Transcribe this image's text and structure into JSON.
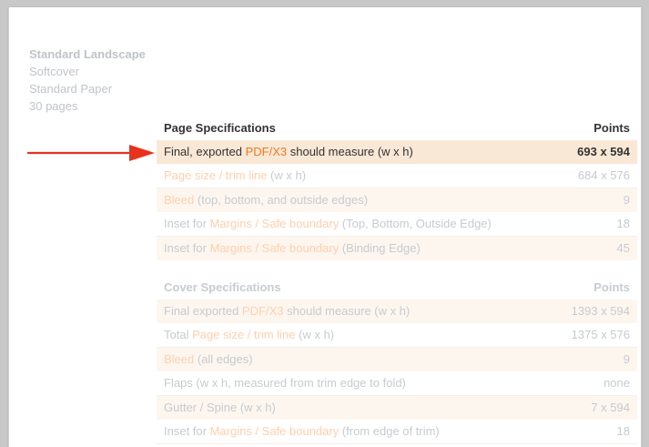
{
  "book_info": {
    "title": "Standard Landscape",
    "cover": "Softcover",
    "paper": "Standard Paper",
    "pages": "30 pages"
  },
  "page_specs": {
    "header": {
      "label": "Page Specifications",
      "value": "Points"
    },
    "rows": [
      {
        "pre": "Final, exported ",
        "hl": "PDF/X3",
        "post": " should measure (w x h)",
        "value": "693 x 594"
      },
      {
        "pre": "",
        "hl": "Page size / trim line",
        "post": " (w x h)",
        "value": "684 x 576"
      },
      {
        "pre": "",
        "hl": "Bleed",
        "post": " (top, bottom, and outside edges)",
        "value": "9"
      },
      {
        "pre": "Inset for ",
        "hl": "Margins / Safe boundary",
        "post": " (Top, Bottom, Outside Edge)",
        "value": "18"
      },
      {
        "pre": "Inset for ",
        "hl": "Margins / Safe boundary",
        "post": " (Binding Edge)",
        "value": "45"
      }
    ]
  },
  "cover_specs": {
    "header": {
      "label": "Cover Specifications",
      "value": "Points"
    },
    "rows": [
      {
        "pre": "Final exported ",
        "hl": "PDF/X3",
        "post": " should measure (w x h)",
        "value": "1393 x 594"
      },
      {
        "pre": "Total ",
        "hl": "Page size / trim line",
        "post": " (w x h)",
        "value": "1375 x 576"
      },
      {
        "pre": "",
        "hl": "Bleed",
        "post": " (all edges)",
        "value": "9"
      },
      {
        "pre": "Flaps (w x h, measured from trim edge to fold)",
        "hl": "",
        "post": "",
        "value": "none"
      },
      {
        "pre": "Gutter / Spine (w x h)",
        "hl": "",
        "post": "",
        "value": "7 x 594"
      },
      {
        "pre": "Inset for ",
        "hl": "Margins / Safe boundary",
        "post": " (from edge of trim)",
        "value": "18"
      }
    ]
  },
  "colors": {
    "arrow": "#e8321e",
    "highlight_link": "#f07a22",
    "highlight_row": "#fae8d6"
  },
  "icons": {
    "pointer": "red-arrow-icon"
  }
}
